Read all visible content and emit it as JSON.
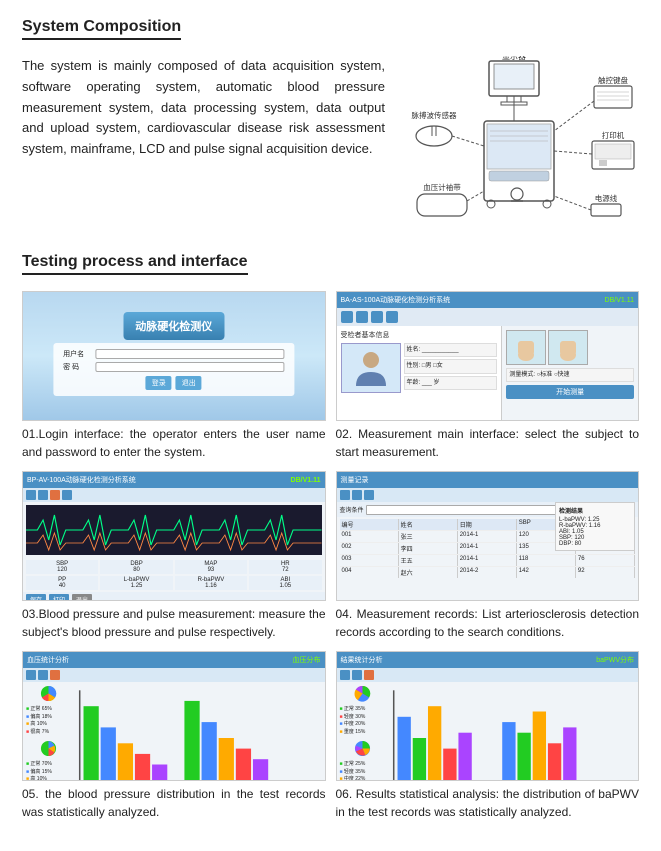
{
  "sections": {
    "system_composition": {
      "heading": "System Composition",
      "description": "The system is mainly composed of data acquisition system, software operating system, automatic blood pressure measurement system, data processing system, data output and upload system, cardiovascular disease risk assessment system, mainframe, LCD and pulse signal acquisition device."
    },
    "testing_process": {
      "heading": "Testing process and interface",
      "cells": [
        {
          "id": "screen1",
          "caption": "01.Login interface: the operator enters the user name and password to enter the system."
        },
        {
          "id": "screen2",
          "caption": "02. Measurement main interface: select the subject to start measurement."
        },
        {
          "id": "screen3",
          "caption": "03.Blood pressure and pulse measurement: measure the subject's blood pressure and pulse respectively."
        },
        {
          "id": "screen4",
          "caption": "04. Measurement records: List arteriosclerosis detection records according to the search conditions."
        },
        {
          "id": "screen5",
          "caption": "05. the blood pressure distribution in the test records was statistically analyzed."
        },
        {
          "id": "screen6",
          "caption": "06. Results statistical analysis: the distribution of baPWV in the test records was statistically analyzed."
        }
      ]
    },
    "diagram": {
      "labels": {
        "monitor": "显示器",
        "pulse_sensor": "脉搏波传感器",
        "keyboard": "触控键盘",
        "printer": "打印机",
        "bp_cuff": "血压计袖带",
        "power": "电源线"
      }
    }
  }
}
